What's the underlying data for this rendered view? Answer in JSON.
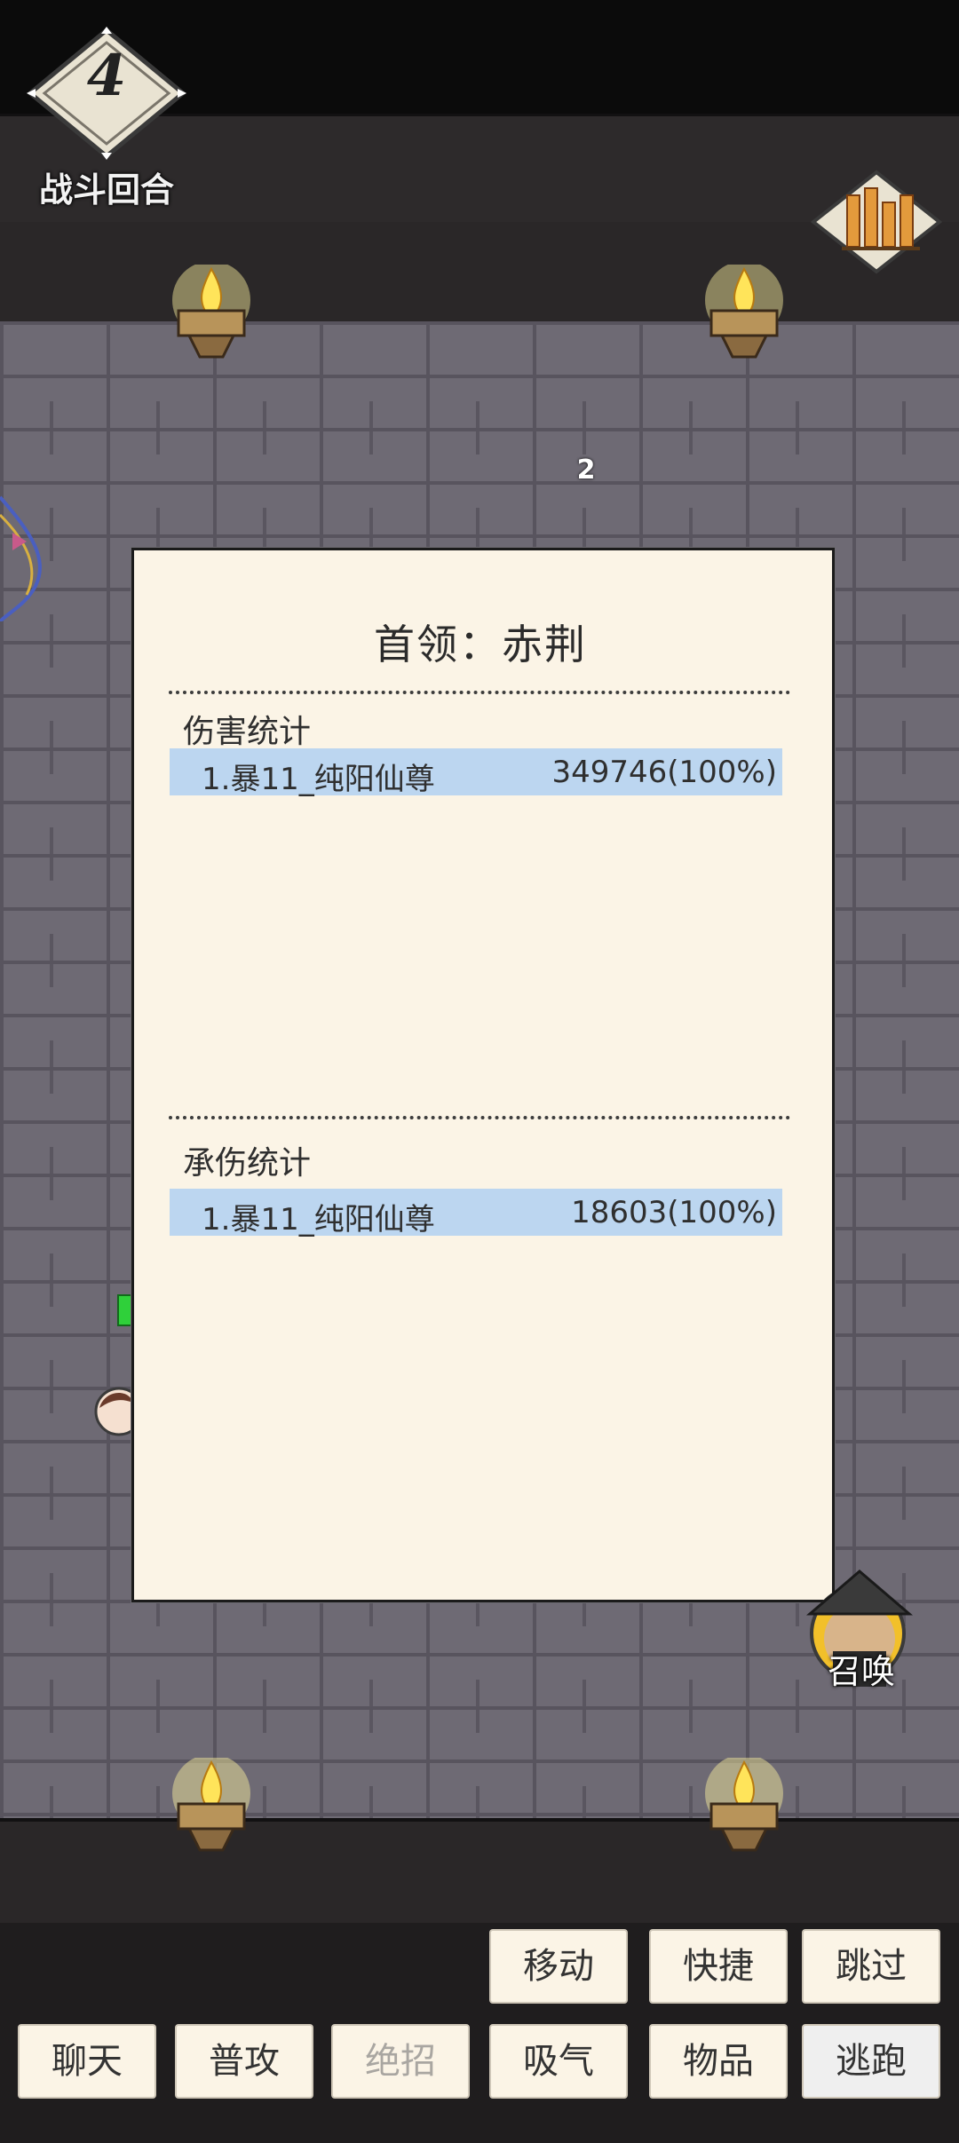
{
  "round": {
    "number": "4",
    "label": "战斗回合"
  },
  "float_number": "2",
  "panel": {
    "title": "首领：赤荆",
    "damage": {
      "label": "伤害统计",
      "rows": [
        {
          "name": "1.暴11_纯阳仙尊",
          "value": "349746(100%)"
        }
      ]
    },
    "taken": {
      "label": "承伤统计",
      "rows": [
        {
          "name": "1.暴11_纯阳仙尊",
          "value": "18603(100%)"
        }
      ]
    }
  },
  "summon_label": "召唤",
  "actions_top": [
    "移动",
    "快捷",
    "跳过"
  ],
  "actions_bottom": [
    "聊天",
    "普攻",
    "绝招",
    "吸气",
    "物品",
    "逃跑"
  ],
  "icons": {
    "round_badge": "diamond-badge-icon",
    "stats": "bar-chart-icon",
    "torch": "torch-icon",
    "summon": "straw-hat-warrior-avatar"
  },
  "colors": {
    "panel_bg": "#fbf4e6",
    "row_highlight": "#bcd6f0",
    "wall": "#6e6a74"
  }
}
